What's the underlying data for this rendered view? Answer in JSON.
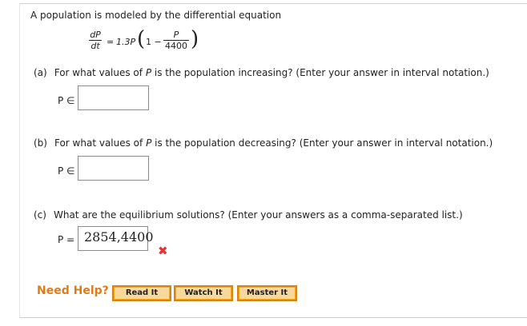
{
  "intro": "A population is modeled by the differential equation",
  "equation": {
    "lhs_num": "dP",
    "lhs_den": "dt",
    "equals": "=",
    "coef": "1.3P",
    "inner_one": "1 −",
    "rhs_num": "P",
    "rhs_den": "4400"
  },
  "questions": [
    {
      "label": "(a)",
      "text_pre": "For what values of ",
      "var": "P",
      "text_post": " is the population increasing? (Enter your answer in interval notation.)",
      "answer_prefix": "P ∈",
      "value": ""
    },
    {
      "label": "(b)",
      "text_pre": "For what values of ",
      "var": "P",
      "text_post": " is the population decreasing? (Enter your answer in interval notation.)",
      "answer_prefix": "P ∈",
      "value": ""
    },
    {
      "label": "(c)",
      "text": "What are the equilibrium solutions? (Enter your answers as a comma-separated list.)",
      "answer_prefix": "P =",
      "value": "2854,4400",
      "status": "incorrect"
    }
  ],
  "help": {
    "label": "Need Help?",
    "buttons": [
      "Read It",
      "Watch It",
      "Master It"
    ]
  },
  "colors": {
    "accent": "#e07b18",
    "button": "#f1a623",
    "incorrect": "#e03434"
  },
  "icons": {
    "incorrect": "x-mark-icon"
  }
}
